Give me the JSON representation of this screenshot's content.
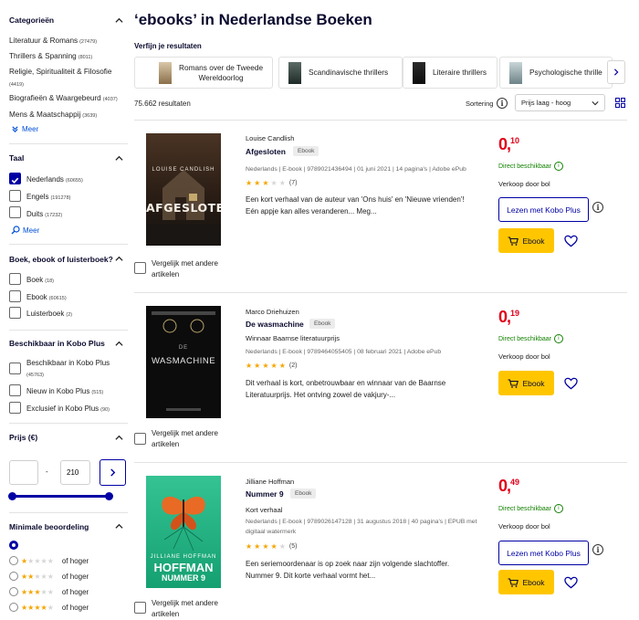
{
  "sidebar": {
    "categories": {
      "title": "Categorieën",
      "items": [
        {
          "label": "Literatuur & Romans",
          "count": "(27479)"
        },
        {
          "label": "Thrillers & Spanning",
          "count": "(8011)"
        },
        {
          "label": "Religie, Spiritualiteit & Filosofie",
          "count": "(4419)"
        },
        {
          "label": "Biografieën & Waargebeurd",
          "count": "(4037)"
        },
        {
          "label": "Mens & Maatschappij",
          "count": "(3639)"
        }
      ],
      "more": "Meer"
    },
    "taal": {
      "title": "Taal",
      "items": [
        {
          "label": "Nederlands",
          "count": "(60655)",
          "checked": true
        },
        {
          "label": "Engels",
          "count": "(191278)",
          "checked": false
        },
        {
          "label": "Duits",
          "count": "(17232)",
          "checked": false
        }
      ],
      "more": "Meer"
    },
    "format": {
      "title": "Boek, ebook of luisterboek?",
      "items": [
        {
          "label": "Boek",
          "count": "(18)"
        },
        {
          "label": "Ebook",
          "count": "(60615)"
        },
        {
          "label": "Luisterboek",
          "count": "(2)"
        }
      ]
    },
    "kobo": {
      "title": "Beschikbaar in Kobo Plus",
      "items": [
        {
          "label": "Beschikbaar in Kobo Plus",
          "count": "(45763)"
        },
        {
          "label": "Nieuw in Kobo Plus",
          "count": "(515)"
        },
        {
          "label": "Exclusief in Kobo Plus",
          "count": "(90)"
        }
      ]
    },
    "price": {
      "title": "Prijs (€)",
      "min_value": "",
      "separator": "-",
      "max_value": "210",
      "slider_min": 0,
      "slider_max": 1
    },
    "rating": {
      "title": "Minimale beoordeling",
      "options": [
        {
          "stars": 0,
          "label": "",
          "selected": true
        },
        {
          "stars": 1,
          "label": "of hoger",
          "selected": false
        },
        {
          "stars": 2,
          "label": "of hoger",
          "selected": false
        },
        {
          "stars": 3,
          "label": "of hoger",
          "selected": false
        },
        {
          "stars": 4,
          "label": "of hoger",
          "selected": false
        }
      ]
    }
  },
  "main": {
    "title": "‘ebooks’ in Nederlandse Boeken",
    "refine_label": "Verfijn je resultaten",
    "chips": [
      {
        "label_1": "Romans over de Tweede",
        "label_2": "Wereldoorlog"
      },
      {
        "label_1": "Scandinavische thrillers",
        "label_2": ""
      },
      {
        "label_1": "Literaire thrillers",
        "label_2": ""
      },
      {
        "label_1": "Psychologische thrille",
        "label_2": ""
      }
    ],
    "results_count": "75.662 resultaten",
    "sort_label": "Sortering",
    "sort_value": "Prijs laag - hoog",
    "compare_label": "Vergelijk met andere artikelen",
    "products": [
      {
        "author": "Louise Candlish",
        "title": "Afgesloten",
        "badge": "Ebook",
        "subtitle": "",
        "meta": "Nederlands | E-book | 9789021436494 | 01 juni 2021 | 14 pagina's | Adobe ePub",
        "rating": 3,
        "reviews": "(7)",
        "desc": "Een kort verhaal van de auteur van 'Ons huis' en 'Nieuwe vrienden'! Eén appje kan alles veranderen... Meg...",
        "price_main": "0,",
        "price_cents": "10",
        "availability": "Direct beschikbaar",
        "seller": "Verkoop door bol",
        "kobo_label": "Lezen met Kobo Plus",
        "buy_label": "Ebook",
        "cover_author": "LOUISE CANDLISH",
        "cover_title": "AFGESLOTEN",
        "cover_colors": [
          "#3b2a1e",
          "#1c1a17"
        ]
      },
      {
        "author": "Marco Driehuizen",
        "title": "De wasmachine",
        "badge": "Ebook",
        "subtitle": "Winnaar Baarnse literatuurprijs",
        "meta": "Nederlands | E-book | 9789464055405 | 08 februari 2021 | Adobe ePub",
        "rating": 5,
        "reviews": "(2)",
        "desc": "Dit verhaal is kort, onbetrouwbaar en winnaar van de Baarnse Literatuurprijs. Het ontving zowel de vakjury-...",
        "price_main": "0,",
        "price_cents": "19",
        "availability": "Direct beschikbaar",
        "seller": "Verkoop door bol",
        "kobo_label": "",
        "buy_label": "Ebook",
        "cover_author": "",
        "cover_title": "DE WASMACHINE",
        "cover_colors": [
          "#111111",
          "#0b0b0b"
        ]
      },
      {
        "author": "Jilliane Hoffman",
        "title": "Nummer 9",
        "badge": "Ebook",
        "subtitle": "Kort verhaal",
        "meta": "Nederlands | E-book | 9789026147128 | 31 augustus 2018 | 40 pagina's | EPUB met digitaal watermerk",
        "rating": 4,
        "reviews": "(5)",
        "desc": "Een seriemoordenaar is op zoek naar zijn volgende slachtoffer. Nummer 9. Dit korte verhaal vormt het...",
        "price_main": "0,",
        "price_cents": "49",
        "availability": "Direct beschikbaar",
        "seller": "Verkoop door bol",
        "kobo_label": "Lezen met Kobo Plus",
        "buy_label": "Ebook",
        "cover_author": "JILLIANE HOFFMAN",
        "cover_title": "NUMMER 9",
        "cover_colors": [
          "#2fb88a",
          "#13966c"
        ]
      }
    ]
  },
  "colors": {
    "brand_blue": "#0000a4",
    "price_red": "#e0001a",
    "buy_yellow": "#ffc600",
    "available_green": "#128000",
    "star": "#f5a500"
  }
}
